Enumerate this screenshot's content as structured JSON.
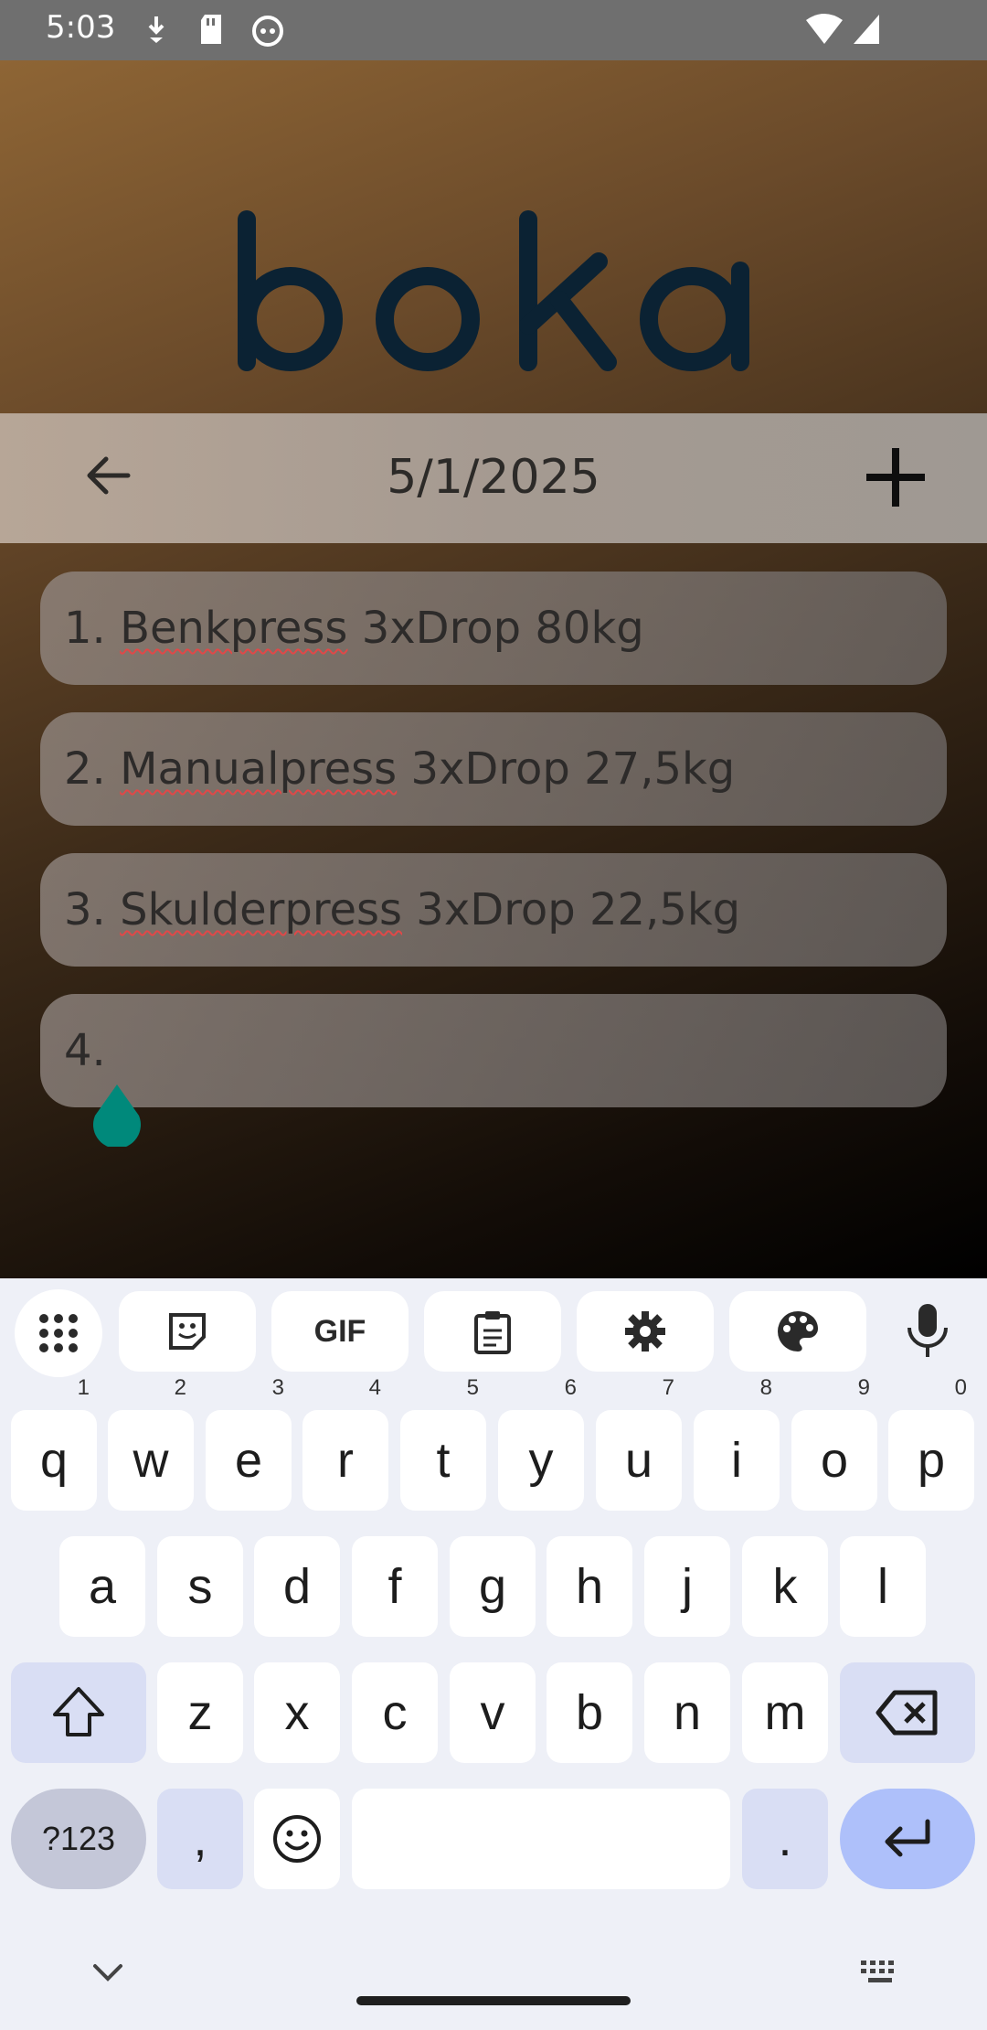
{
  "status_bar": {
    "time": "5:03",
    "icons": [
      "download-icon",
      "sd-card-icon",
      "cat-app-icon",
      "wifi-icon",
      "signal-icon"
    ]
  },
  "app": {
    "logo_text": "boka",
    "date": "5/1/2025",
    "exercises": [
      {
        "number": "1.",
        "name": "Benkpress",
        "detail": " 3xDrop 80kg"
      },
      {
        "number": "2.",
        "name": "Manualpress",
        "detail": " 3xDrop 27,5kg"
      },
      {
        "number": "3.",
        "name": "Skulderpress",
        "detail": " 3xDrop 22,5kg"
      },
      {
        "number": "4.",
        "name": "",
        "detail": ""
      }
    ]
  },
  "keyboard": {
    "toolbar": [
      "apps-grid-icon",
      "sticker-icon",
      "GIF",
      "clipboard-icon",
      "settings-icon",
      "palette-icon",
      "mic-icon"
    ],
    "row1": [
      {
        "key": "q",
        "hint": "1"
      },
      {
        "key": "w",
        "hint": "2"
      },
      {
        "key": "e",
        "hint": "3"
      },
      {
        "key": "r",
        "hint": "4"
      },
      {
        "key": "t",
        "hint": "5"
      },
      {
        "key": "y",
        "hint": "6"
      },
      {
        "key": "u",
        "hint": "7"
      },
      {
        "key": "i",
        "hint": "8"
      },
      {
        "key": "o",
        "hint": "9"
      },
      {
        "key": "p",
        "hint": "0"
      }
    ],
    "row2": [
      "a",
      "s",
      "d",
      "f",
      "g",
      "h",
      "j",
      "k",
      "l"
    ],
    "row3": [
      "z",
      "x",
      "c",
      "v",
      "b",
      "n",
      "m"
    ],
    "symbols_label": "?123",
    "comma": ",",
    "period": "."
  },
  "colors": {
    "accent_handle": "#00897b",
    "spell_underline": "#e04848",
    "enter_key": "#aec0fa"
  }
}
